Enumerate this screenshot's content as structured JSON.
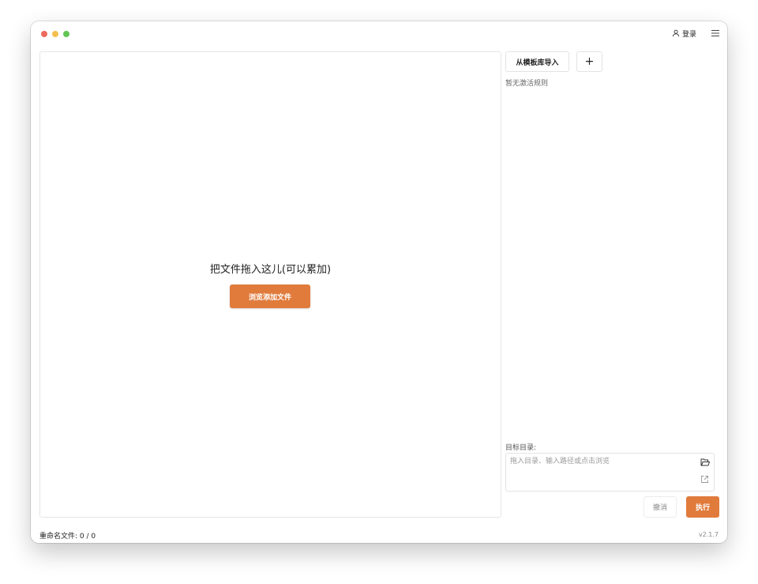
{
  "header": {
    "login_label": "登录",
    "user_icon": "user-icon",
    "menu_icon": "hamburger-menu-icon"
  },
  "dropzone": {
    "hint": "把文件拖入这儿(可以累加)",
    "browse_label": "浏览添加文件"
  },
  "rules": {
    "import_label": "从模板库导入",
    "add_label": "+",
    "empty_text": "暂无激活规则"
  },
  "target": {
    "label": "目标目录:",
    "placeholder": "拖入目录、输入路径或点击浏览",
    "value": "",
    "browse_icon": "folder-open-icon",
    "open_icon": "external-link-icon"
  },
  "actions": {
    "cancel_label": "撤消",
    "run_label": "执行"
  },
  "status": {
    "renamed_label": "重命名文件: ",
    "renamed_count": "0 / 0",
    "version": "v2.1.7"
  },
  "colors": {
    "accent": "#e07b3c",
    "traffic_close": "#ed6a5e",
    "traffic_minimize": "#f5bf4f",
    "traffic_zoom": "#61c554"
  }
}
